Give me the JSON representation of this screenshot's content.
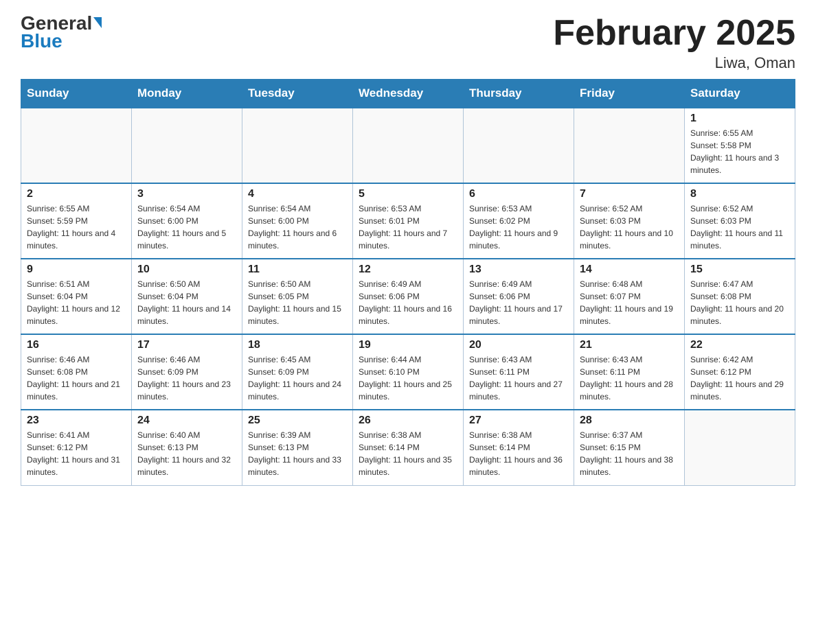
{
  "logo": {
    "general": "General",
    "blue": "Blue",
    "triangle_color": "#1a7bbf"
  },
  "title": "February 2025",
  "location": "Liwa, Oman",
  "days_of_week": [
    "Sunday",
    "Monday",
    "Tuesday",
    "Wednesday",
    "Thursday",
    "Friday",
    "Saturday"
  ],
  "weeks": [
    [
      {
        "day": "",
        "info": ""
      },
      {
        "day": "",
        "info": ""
      },
      {
        "day": "",
        "info": ""
      },
      {
        "day": "",
        "info": ""
      },
      {
        "day": "",
        "info": ""
      },
      {
        "day": "",
        "info": ""
      },
      {
        "day": "1",
        "info": "Sunrise: 6:55 AM\nSunset: 5:58 PM\nDaylight: 11 hours and 3 minutes."
      }
    ],
    [
      {
        "day": "2",
        "info": "Sunrise: 6:55 AM\nSunset: 5:59 PM\nDaylight: 11 hours and 4 minutes."
      },
      {
        "day": "3",
        "info": "Sunrise: 6:54 AM\nSunset: 6:00 PM\nDaylight: 11 hours and 5 minutes."
      },
      {
        "day": "4",
        "info": "Sunrise: 6:54 AM\nSunset: 6:00 PM\nDaylight: 11 hours and 6 minutes."
      },
      {
        "day": "5",
        "info": "Sunrise: 6:53 AM\nSunset: 6:01 PM\nDaylight: 11 hours and 7 minutes."
      },
      {
        "day": "6",
        "info": "Sunrise: 6:53 AM\nSunset: 6:02 PM\nDaylight: 11 hours and 9 minutes."
      },
      {
        "day": "7",
        "info": "Sunrise: 6:52 AM\nSunset: 6:03 PM\nDaylight: 11 hours and 10 minutes."
      },
      {
        "day": "8",
        "info": "Sunrise: 6:52 AM\nSunset: 6:03 PM\nDaylight: 11 hours and 11 minutes."
      }
    ],
    [
      {
        "day": "9",
        "info": "Sunrise: 6:51 AM\nSunset: 6:04 PM\nDaylight: 11 hours and 12 minutes."
      },
      {
        "day": "10",
        "info": "Sunrise: 6:50 AM\nSunset: 6:04 PM\nDaylight: 11 hours and 14 minutes."
      },
      {
        "day": "11",
        "info": "Sunrise: 6:50 AM\nSunset: 6:05 PM\nDaylight: 11 hours and 15 minutes."
      },
      {
        "day": "12",
        "info": "Sunrise: 6:49 AM\nSunset: 6:06 PM\nDaylight: 11 hours and 16 minutes."
      },
      {
        "day": "13",
        "info": "Sunrise: 6:49 AM\nSunset: 6:06 PM\nDaylight: 11 hours and 17 minutes."
      },
      {
        "day": "14",
        "info": "Sunrise: 6:48 AM\nSunset: 6:07 PM\nDaylight: 11 hours and 19 minutes."
      },
      {
        "day": "15",
        "info": "Sunrise: 6:47 AM\nSunset: 6:08 PM\nDaylight: 11 hours and 20 minutes."
      }
    ],
    [
      {
        "day": "16",
        "info": "Sunrise: 6:46 AM\nSunset: 6:08 PM\nDaylight: 11 hours and 21 minutes."
      },
      {
        "day": "17",
        "info": "Sunrise: 6:46 AM\nSunset: 6:09 PM\nDaylight: 11 hours and 23 minutes."
      },
      {
        "day": "18",
        "info": "Sunrise: 6:45 AM\nSunset: 6:09 PM\nDaylight: 11 hours and 24 minutes."
      },
      {
        "day": "19",
        "info": "Sunrise: 6:44 AM\nSunset: 6:10 PM\nDaylight: 11 hours and 25 minutes."
      },
      {
        "day": "20",
        "info": "Sunrise: 6:43 AM\nSunset: 6:11 PM\nDaylight: 11 hours and 27 minutes."
      },
      {
        "day": "21",
        "info": "Sunrise: 6:43 AM\nSunset: 6:11 PM\nDaylight: 11 hours and 28 minutes."
      },
      {
        "day": "22",
        "info": "Sunrise: 6:42 AM\nSunset: 6:12 PM\nDaylight: 11 hours and 29 minutes."
      }
    ],
    [
      {
        "day": "23",
        "info": "Sunrise: 6:41 AM\nSunset: 6:12 PM\nDaylight: 11 hours and 31 minutes."
      },
      {
        "day": "24",
        "info": "Sunrise: 6:40 AM\nSunset: 6:13 PM\nDaylight: 11 hours and 32 minutes."
      },
      {
        "day": "25",
        "info": "Sunrise: 6:39 AM\nSunset: 6:13 PM\nDaylight: 11 hours and 33 minutes."
      },
      {
        "day": "26",
        "info": "Sunrise: 6:38 AM\nSunset: 6:14 PM\nDaylight: 11 hours and 35 minutes."
      },
      {
        "day": "27",
        "info": "Sunrise: 6:38 AM\nSunset: 6:14 PM\nDaylight: 11 hours and 36 minutes."
      },
      {
        "day": "28",
        "info": "Sunrise: 6:37 AM\nSunset: 6:15 PM\nDaylight: 11 hours and 38 minutes."
      },
      {
        "day": "",
        "info": ""
      }
    ]
  ]
}
